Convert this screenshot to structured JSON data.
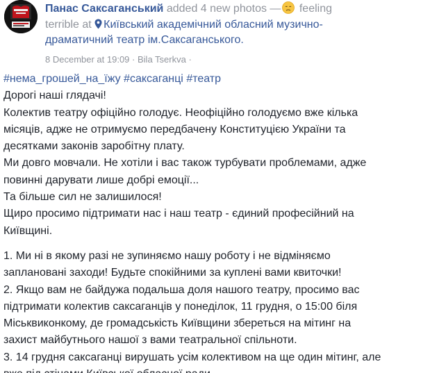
{
  "post": {
    "author": "Панас Саксаганський",
    "action": "added 4 new photos —",
    "feeling_prefix": "feeling",
    "feeling": "terrible at",
    "place_line1": "Київський академічний обласний музично-",
    "place_line2": "драматичний театр ім.Саксаганського.",
    "timestamp": "8 December at 19:09",
    "separator": "·",
    "location": "Bila Tserkva",
    "separator2": "·",
    "hashtags": [
      "#нема_грошей_на_їжу",
      "#саксаганці",
      "#театр"
    ],
    "paragraph1": [
      "Дорогі наші глядачі!",
      "Колектив театру офіційно голодує. Неофіційно голодуємо вже кілька",
      "місяців, адже не отримуємо передбачену Конституцією України та",
      "десятками законів заробітну плату.",
      "Ми довго мовчали. Не хотіли і вас також турбувати проблемами, адже",
      "повинні дарувати лише добрі емоції...",
      "Та більше сил не залишилося!",
      "Щиро просимо підтримати нас і наш театр - єдиний професійний на",
      "Київщині."
    ],
    "paragraph2": [
      "1. Ми ні в якому разі не зупиняємо нашу роботу і не відміняємо",
      "заплановані заходи! Будьте спокійними за куплені вами квиточки!",
      "2. Якщо вам не байдужа подальша доля нашого театру, просимо вас",
      "підтримати колектив саксаганців у понеділок, 11 грудня, о 15:00 біля",
      "Міськвиконкому, де громадськість Київщини збереться на мітинг на",
      "захист майбутнього нашої з вами театральної спільноти.",
      "3. 14 грудня саксаганці вирушать усім колективом на ще один мітинг, але",
      "вже під стінами Київської обласної ради."
    ]
  },
  "colors": {
    "link": "#365899",
    "muted": "#90949c",
    "text": "#1d2129",
    "avatar_bg": "#121212",
    "avatar_accent": "#c0141c"
  },
  "icons": {
    "feeling_emoji": "sad-face-emoji",
    "place": "map-pin-icon",
    "avatar": "theatre-logo-avatar"
  }
}
